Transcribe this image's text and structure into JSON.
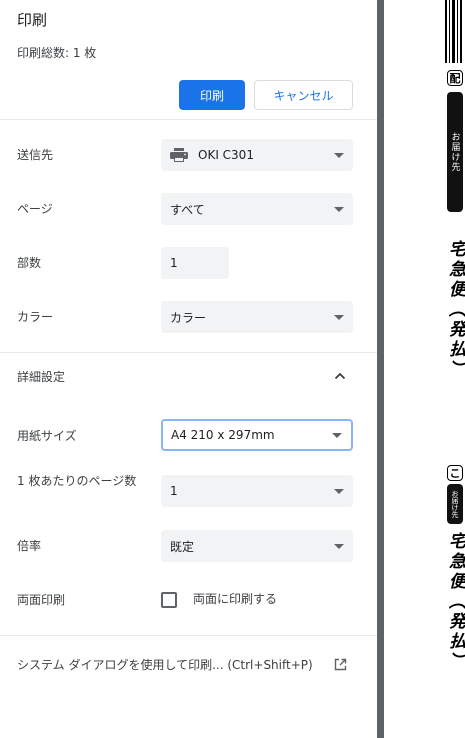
{
  "header": {
    "title": "印刷",
    "sheet_count": "印刷総数: 1 枚",
    "print_button": "印刷",
    "cancel_button": "キャンセル"
  },
  "settings": {
    "destination": {
      "label": "送信先",
      "value": "OKI C301",
      "icon": "printer-icon"
    },
    "pages": {
      "label": "ページ",
      "value": "すべて"
    },
    "copies": {
      "label": "部数",
      "value": "1"
    },
    "color": {
      "label": "カラー",
      "value": "カラー"
    }
  },
  "advanced": {
    "label": "詳細設定",
    "paper_size": {
      "label": "用紙サイズ",
      "value": "A4 210 x 297mm"
    },
    "pages_per_sheet": {
      "label": "1 枚あたりのページ数",
      "value": "1"
    },
    "scale": {
      "label": "倍率",
      "value": "既定"
    },
    "duplex": {
      "label": "両面印刷",
      "checkbox_label": "両面に印刷する",
      "checked": false
    }
  },
  "system_dialog": "システム ダイアログを使用して印刷... (Ctrl+Shift+P)",
  "preview": {
    "box1": "配",
    "pill1": "お届け先",
    "vtext1": "宅急便（発払）",
    "box2": "こ",
    "pill2": "お届け先",
    "vtext2": "宅急便（発払）"
  },
  "colors": {
    "accent": "#1a73e8",
    "scrollbar": "#5f6368"
  }
}
